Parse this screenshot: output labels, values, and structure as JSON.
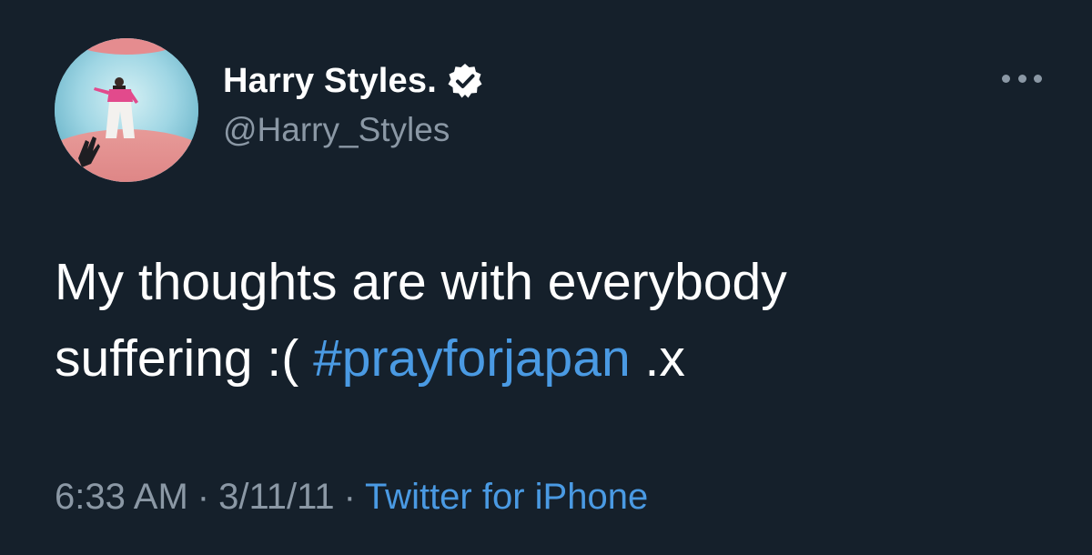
{
  "author": {
    "display_name": "Harry Styles.",
    "handle": "@Harry_Styles",
    "verified_icon": "verified-badge-icon",
    "avatar_icon": "profile-avatar"
  },
  "tweet": {
    "line1": "My thoughts are with everybody",
    "line2_prefix": "suffering :( ",
    "hashtag": "#prayforjapan",
    "line2_suffix": " .x"
  },
  "meta": {
    "time": "6:33 AM",
    "separator": "·",
    "date": "3/11/11",
    "source": "Twitter for iPhone"
  },
  "more_icon": "more-options-icon",
  "colors": {
    "background": "#15202b",
    "text": "#ffffff",
    "secondary": "#8b98a5",
    "link": "#4a9ae3"
  }
}
